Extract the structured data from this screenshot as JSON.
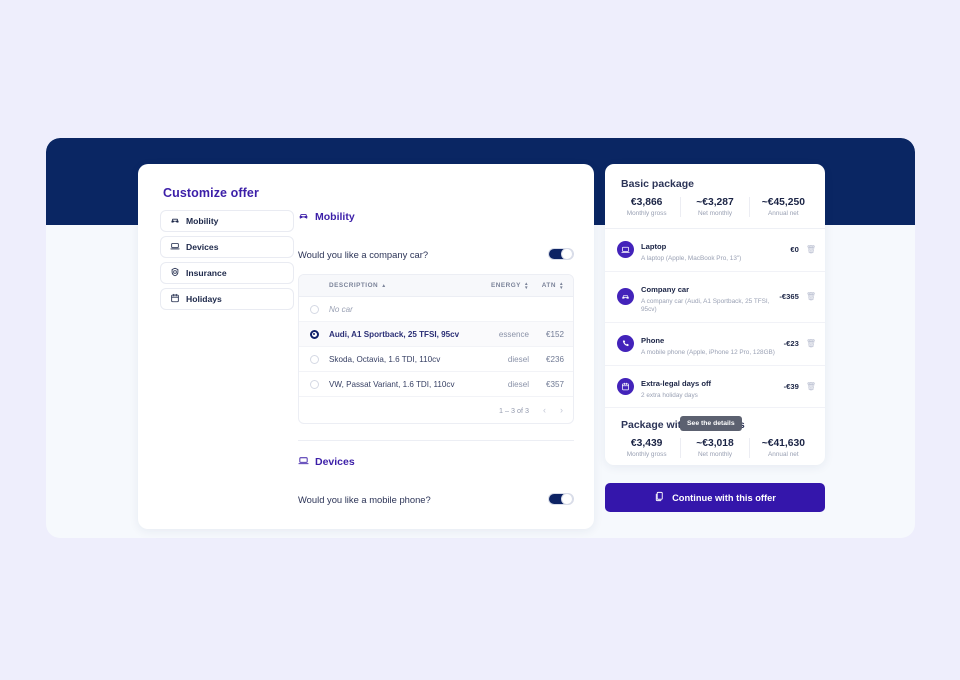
{
  "frame": {
    "header_band_color": "#0a2663",
    "page_background": "#eeeefc",
    "content_background": "#f6f9fd"
  },
  "main_card": {
    "title": "Customize offer",
    "sidebar": {
      "items": [
        {
          "label": "Mobility",
          "icon": "car-icon"
        },
        {
          "label": "Devices",
          "icon": "laptop-icon"
        },
        {
          "label": "Insurance",
          "icon": "shield-icon"
        },
        {
          "label": "Holidays",
          "icon": "calendar-icon"
        }
      ]
    },
    "sections": [
      {
        "heading": "Mobility",
        "icon": "car-icon",
        "question": "Would you like a company car?",
        "toggle_state": "on"
      },
      {
        "heading": "Devices",
        "icon": "laptop-icon",
        "question": "Would you like a mobile phone?",
        "toggle_state": "on"
      }
    ],
    "car_table": {
      "columns": [
        {
          "label": "DESCRIPTION",
          "sort": "asc"
        },
        {
          "label": "ENERGY",
          "sort": "none"
        },
        {
          "label": "ATN",
          "sort": "none"
        }
      ],
      "rows": [
        {
          "description": "No car",
          "energy": "",
          "atn": "",
          "selected": false,
          "muted": true
        },
        {
          "description": "Audi, A1 Sportback, 25 TFSI, 95cv",
          "energy": "essence",
          "atn": "€152",
          "selected": true,
          "muted": false
        },
        {
          "description": "Skoda, Octavia, 1.6 TDI, 110cv",
          "energy": "diesel",
          "atn": "€236",
          "selected": false,
          "muted": false
        },
        {
          "description": "VW, Passat Variant, 1.6 TDI, 110cv",
          "energy": "diesel",
          "atn": "€357",
          "selected": false,
          "muted": false
        }
      ],
      "pagination": {
        "range_label": "1 – 3 of 3",
        "prev_icon": "chevron-left-icon",
        "next_icon": "chevron-right-icon"
      }
    }
  },
  "summary": {
    "title": "Basic package",
    "stats": [
      {
        "amount": "€3,866",
        "label": "Monthly gross"
      },
      {
        "amount": "~€3,287",
        "label": "Net monthly"
      },
      {
        "amount": "~€45,250",
        "label": "Annual net"
      }
    ],
    "items": [
      {
        "name": "Laptop",
        "description": "A laptop (Apple, MacBook Pro, 13\")",
        "price": "€0",
        "icon": "laptop-icon"
      },
      {
        "name": "Company car",
        "description": "A company car (Audi, A1 Sportback, 25 TFSI, 95cv)",
        "price": "-€365",
        "icon": "car-icon"
      },
      {
        "name": "Phone",
        "description": "A mobile phone (Apple, iPhone 12 Pro, 128GB)",
        "price": "-€23",
        "icon": "phone-icon"
      },
      {
        "name": "Extra-legal days off",
        "description": "2 extra holiday days",
        "price": "-€39",
        "icon": "calendar-icon"
      }
    ],
    "sub_title": "Package with exchanges",
    "sub_stats": [
      {
        "amount": "€3,439",
        "label": "Monthly gross"
      },
      {
        "amount": "~€3,018",
        "label": "Net monthly"
      },
      {
        "amount": "~€41,630",
        "label": "Annual net"
      }
    ],
    "accent_color": "#4323ba"
  },
  "tooltip": {
    "text": "See the details"
  },
  "continue_button": {
    "label": "Continue with this offer",
    "icon": "document-copy-icon",
    "color": "#3416ab"
  }
}
